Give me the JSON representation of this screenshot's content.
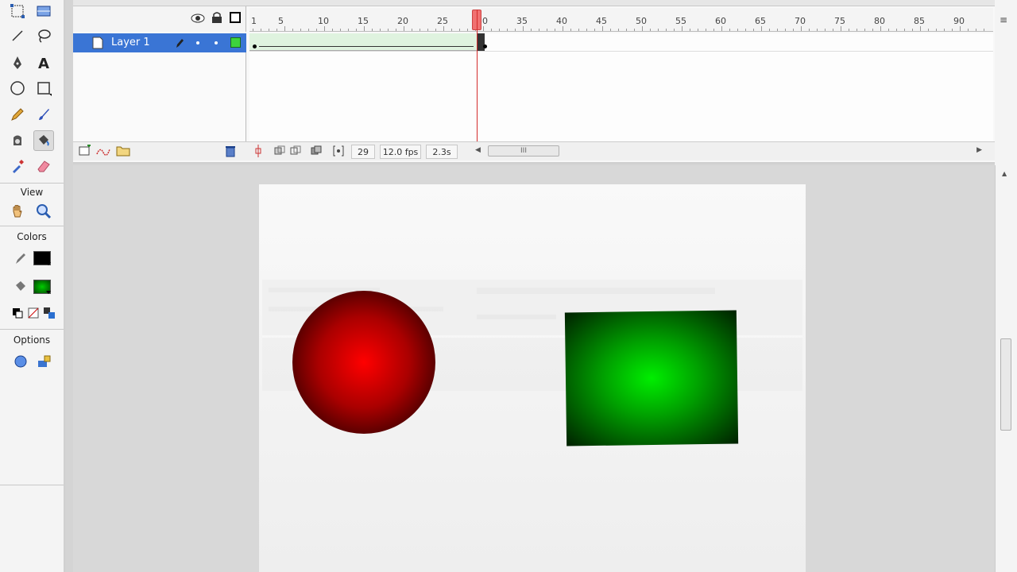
{
  "tools_panel": {
    "sections": {
      "view": "View",
      "colors": "Colors",
      "options": "Options"
    },
    "tools": [
      "free-transform-icon",
      "gradient-transform-icon",
      "line-icon",
      "lasso-icon",
      "pen-icon",
      "text-icon",
      "oval-icon",
      "rectangle-icon",
      "pencil-icon",
      "brush-icon",
      "ink-bottle-icon",
      "paint-bucket-icon",
      "eyedropper-icon",
      "eraser-icon",
      "hand-icon",
      "zoom-icon"
    ],
    "selected_tool": "paint-bucket-icon",
    "stroke_color": "#000000",
    "fill_color": "#008800"
  },
  "timeline": {
    "layer_name": "Layer 1",
    "ruler_ticks": [
      "1",
      "5",
      "10",
      "15",
      "20",
      "25",
      "30",
      "35",
      "40",
      "45",
      "50",
      "55",
      "60",
      "65",
      "70",
      "75",
      "80",
      "85",
      "90"
    ],
    "current_frame": "29",
    "frame_rate": "12.0 fps",
    "elapsed_time": "2.3s",
    "scroll_grip": "III"
  },
  "stage": {
    "circle_gradient": [
      "#ff0000",
      "#000000"
    ],
    "rect_gradient": [
      "#00ee00",
      "#003000"
    ]
  }
}
